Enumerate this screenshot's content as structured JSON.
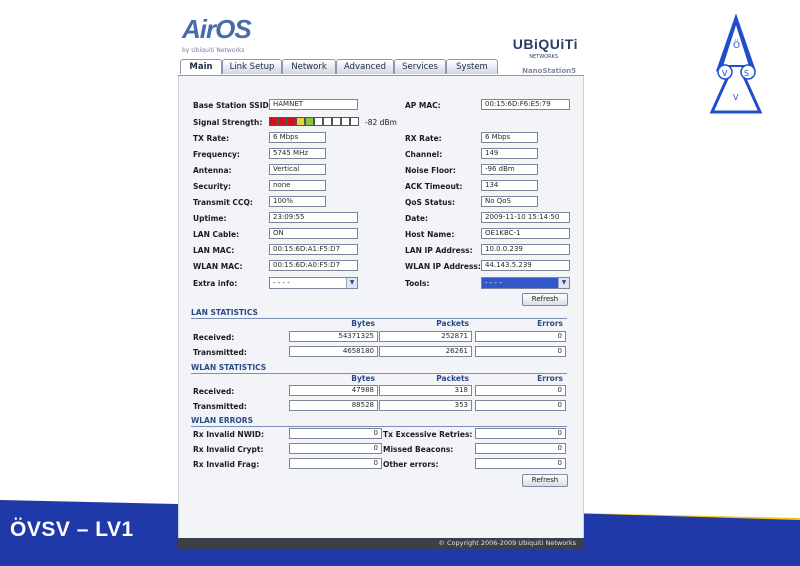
{
  "slide": {
    "footer_text": "ÖVSV – LV1",
    "colors": {
      "banner_blue": "#1f3aa8",
      "banner_yellow": "#f2cc1d",
      "emblem_blue": "#1e4ec9"
    },
    "emblem_letters": {
      "o": "Ö",
      "v1": "V",
      "v2": "V",
      "s": "S"
    }
  },
  "header": {
    "logo": "AirOS",
    "logo_sub": "by Ubiquiti Networks",
    "brand": "UBiQUiTi",
    "brand_sub": "NETWORKS",
    "model": "NanoStation5"
  },
  "tabs": [
    {
      "label": "Main",
      "active": true
    },
    {
      "label": "Link Setup",
      "active": false
    },
    {
      "label": "Network",
      "active": false
    },
    {
      "label": "Advanced",
      "active": false
    },
    {
      "label": "Services",
      "active": false
    },
    {
      "label": "System",
      "active": false
    }
  ],
  "status": {
    "base_station_ssid_label": "Base Station SSID:",
    "base_station_ssid": "HAMNET",
    "ap_mac_label": "AP MAC:",
    "ap_mac": "00:15:6D:F6:E5:79",
    "signal_strength_label": "Signal Strength:",
    "signal_strength": "-82 dBm",
    "signal_level": 0.4,
    "signal_colors": [
      "#d0101a",
      "#d0101a",
      "#d0101a",
      "#e6d23a",
      "#8bc63f",
      "#ffffff",
      "#ffffff",
      "#ffffff",
      "#ffffff",
      "#ffffff"
    ],
    "tx_rate_label": "TX Rate:",
    "tx_rate": "6 Mbps",
    "rx_rate_label": "RX Rate:",
    "rx_rate": "6 Mbps",
    "frequency_label": "Frequency:",
    "frequency": "5745 MHz",
    "channel_label": "Channel:",
    "channel": "149",
    "antenna_label": "Antenna:",
    "antenna": "Vertical",
    "noise_floor_label": "Noise Floor:",
    "noise_floor": "-96 dBm",
    "security_label": "Security:",
    "security": "none",
    "ack_timeout_label": "ACK Timeout:",
    "ack_timeout": "134",
    "transmit_ccq_label": "Transmit CCQ:",
    "transmit_ccq": "100%",
    "qos_status_label": "QoS Status:",
    "qos_status": "No QoS",
    "uptime_label": "Uptime:",
    "uptime": "23:09:55",
    "date_label": "Date:",
    "date": "2009-11-10 15:14:50",
    "lan_cable_label": "LAN Cable:",
    "lan_cable": "ON",
    "host_name_label": "Host Name:",
    "host_name": "OE1KBC-1",
    "lan_mac_label": "LAN MAC:",
    "lan_mac": "00:15:6D:A1:F5:D7",
    "lan_ip_label": "LAN IP Address:",
    "lan_ip": "10.0.0.239",
    "wlan_mac_label": "WLAN MAC:",
    "wlan_mac": "00:15:6D:A0:F5:D7",
    "wlan_ip_label": "WLAN IP Address:",
    "wlan_ip": "44.143.5.239",
    "extra_info_label": "Extra info:",
    "extra_info": "- - - -",
    "tools_label": "Tools:",
    "tools": "- - - -",
    "refresh_label": "Refresh"
  },
  "lan_statistics": {
    "title": "LAN STATISTICS",
    "headers": [
      "Bytes",
      "Packets",
      "Errors"
    ],
    "rows": [
      {
        "label": "Received:",
        "bytes": "54371325",
        "packets": "252871",
        "errors": "0"
      },
      {
        "label": "Transmitted:",
        "bytes": "4658180",
        "packets": "26261",
        "errors": "0"
      }
    ]
  },
  "wlan_statistics": {
    "title": "WLAN STATISTICS",
    "headers": [
      "Bytes",
      "Packets",
      "Errors"
    ],
    "rows": [
      {
        "label": "Received:",
        "bytes": "47988",
        "packets": "318",
        "errors": "0"
      },
      {
        "label": "Transmitted:",
        "bytes": "88528",
        "packets": "353",
        "errors": "0"
      }
    ]
  },
  "wlan_errors": {
    "title": "WLAN ERRORS",
    "rx_invalid_nwid_label": "Rx Invalid NWID:",
    "rx_invalid_nwid": "0",
    "rx_invalid_crypt_label": "Rx Invalid Crypt:",
    "rx_invalid_crypt": "0",
    "rx_invalid_frag_label": "Rx Invalid Frag:",
    "rx_invalid_frag": "0",
    "tx_excessive_retries_label": "Tx Excessive Retries:",
    "tx_excessive_retries": "0",
    "missed_beacons_label": "Missed Beacons:",
    "missed_beacons": "0",
    "other_errors_label": "Other errors:",
    "other_errors": "0",
    "refresh_label": "Refresh"
  },
  "copyright": "© Copyright 2006-2009 Ubiquiti Networks"
}
